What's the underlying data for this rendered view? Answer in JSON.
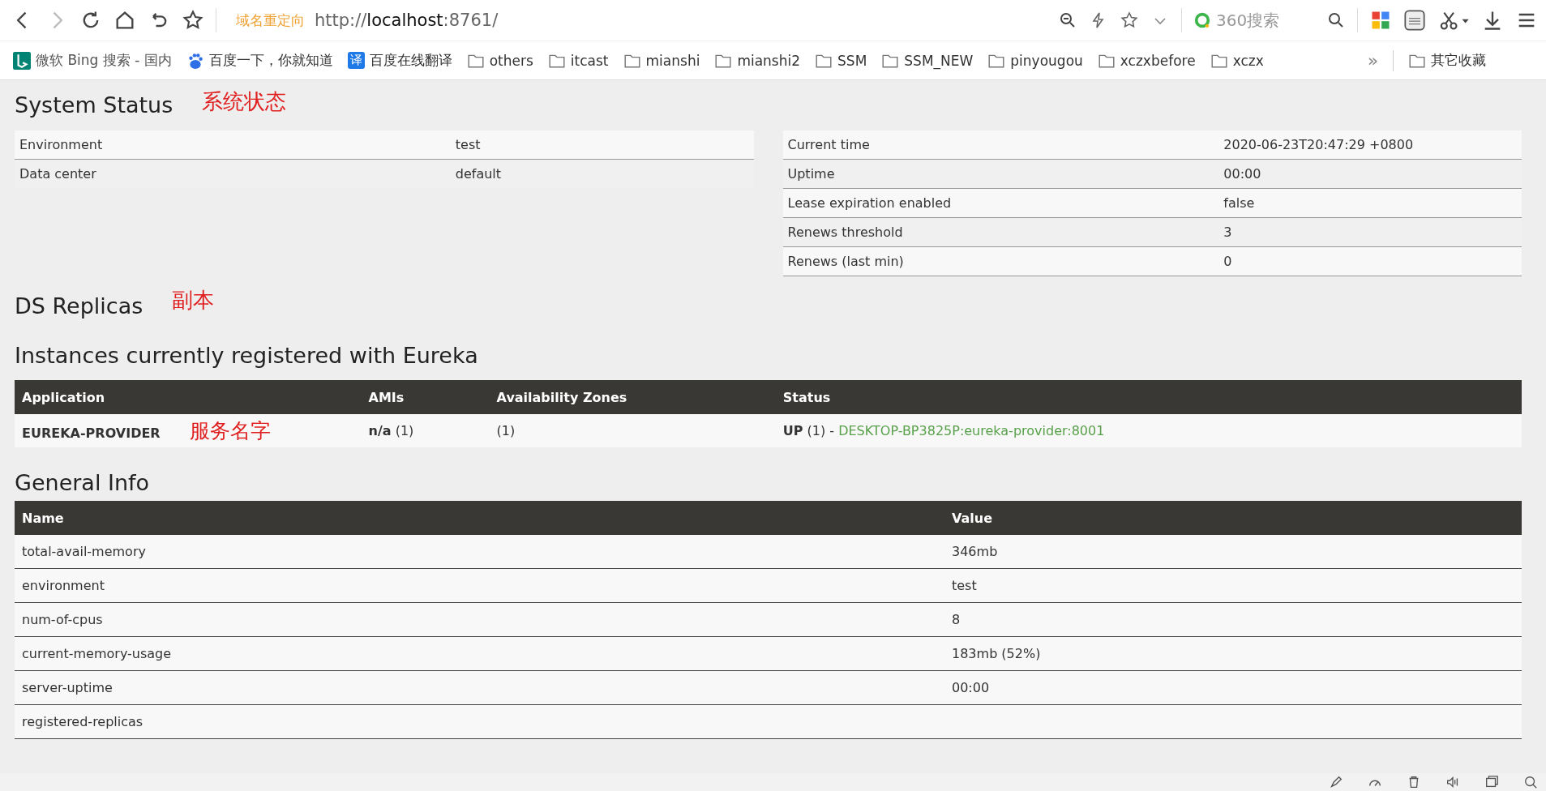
{
  "browser": {
    "redirect_label": "域名重定向",
    "url_prefix": "http://",
    "url_host": "localhost",
    "url_rest": ":8761/",
    "search_engine": "360搜索",
    "bookmarks": [
      {
        "kind": "bing",
        "label": "微软 Bing 搜索 - 国内"
      },
      {
        "kind": "baidu",
        "label": "百度一下，你就知道"
      },
      {
        "kind": "translate",
        "label": "百度在线翻译",
        "badge": "译"
      },
      {
        "kind": "folder",
        "label": "others"
      },
      {
        "kind": "folder",
        "label": "itcast"
      },
      {
        "kind": "folder",
        "label": "mianshi"
      },
      {
        "kind": "folder",
        "label": "mianshi2"
      },
      {
        "kind": "folder",
        "label": "SSM"
      },
      {
        "kind": "folder",
        "label": "SSM_NEW"
      },
      {
        "kind": "folder",
        "label": "pinyougou"
      },
      {
        "kind": "folder",
        "label": "xczxbefore"
      },
      {
        "kind": "folder",
        "label": "xczx"
      }
    ],
    "more": "»",
    "other_bookmarks": "其它收藏"
  },
  "system_status": {
    "title": "System Status",
    "note": "系统状态",
    "left_rows": [
      {
        "name": "Environment",
        "value": "test"
      },
      {
        "name": "Data center",
        "value": "default"
      }
    ],
    "right_rows": [
      {
        "name": "Current time",
        "value": "2020-06-23T20:47:29 +0800"
      },
      {
        "name": "Uptime",
        "value": "00:00"
      },
      {
        "name": "Lease expiration enabled",
        "value": "false"
      },
      {
        "name": "Renews threshold",
        "value": "3"
      },
      {
        "name": "Renews (last min)",
        "value": "0"
      }
    ]
  },
  "ds_replicas": {
    "title": "DS Replicas",
    "note": "副本"
  },
  "instances": {
    "title": "Instances currently registered with Eureka",
    "columns": [
      "Application",
      "AMIs",
      "Availability Zones",
      "Status"
    ],
    "rows": [
      {
        "application": "EUREKA-PROVIDER",
        "note": "服务名字",
        "amis": "**n/a** (1)",
        "zones": "(1)",
        "status": "**UP** (1) -",
        "link": "DESKTOP-BP3825P:eureka-provider:8001"
      }
    ]
  },
  "general_info": {
    "title": "General Info",
    "columns": [
      "Name",
      "Value"
    ],
    "rows": [
      {
        "name": "total-avail-memory",
        "value": "346mb"
      },
      {
        "name": "environment",
        "value": "test"
      },
      {
        "name": "num-of-cpus",
        "value": "8"
      },
      {
        "name": "current-memory-usage",
        "value": "183mb (52%)"
      },
      {
        "name": "server-uptime",
        "value": "00:00"
      },
      {
        "name": "registered-replicas",
        "value": ""
      }
    ]
  }
}
